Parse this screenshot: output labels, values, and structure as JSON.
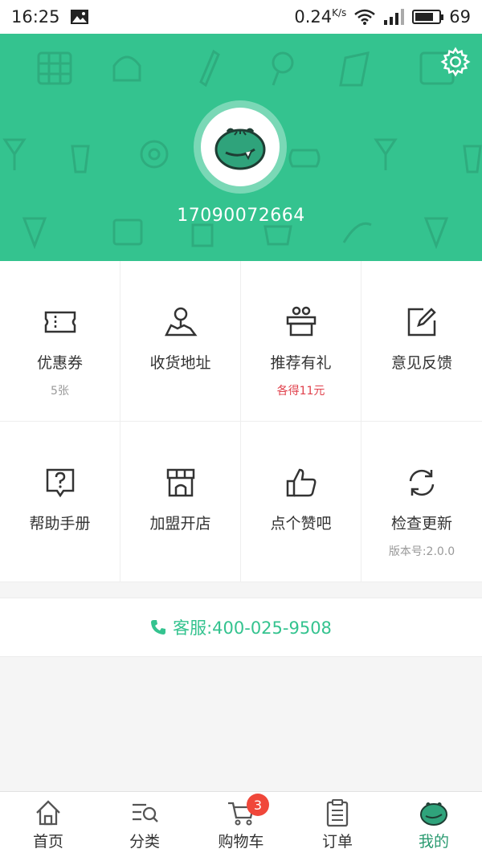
{
  "status_bar": {
    "time": "16:25",
    "network_speed": "0.24",
    "network_unit": "K/s",
    "battery": "69"
  },
  "header": {
    "phone": "17090072664",
    "background_color": "#34c38f"
  },
  "grid": {
    "items": [
      {
        "label": "优惠券",
        "sub": "5张",
        "icon": "ticket-icon"
      },
      {
        "label": "收货地址",
        "sub": "",
        "icon": "map-pin-icon"
      },
      {
        "label": "推荐有礼",
        "sub": "各得11元",
        "icon": "gift-icon"
      },
      {
        "label": "意见反馈",
        "sub": "",
        "icon": "edit-icon"
      },
      {
        "label": "帮助手册",
        "sub": "",
        "icon": "help-icon"
      },
      {
        "label": "加盟开店",
        "sub": "",
        "icon": "store-icon"
      },
      {
        "label": "点个赞吧",
        "sub": "",
        "icon": "thumbs-up-icon"
      },
      {
        "label": "检查更新",
        "sub": "版本号:2.0.0",
        "icon": "refresh-icon"
      }
    ]
  },
  "service": {
    "label": "客服:400-025-9508"
  },
  "tabbar": {
    "items": [
      {
        "label": "首页",
        "icon": "home-icon"
      },
      {
        "label": "分类",
        "icon": "category-search-icon"
      },
      {
        "label": "购物车",
        "icon": "cart-icon",
        "badge": "3"
      },
      {
        "label": "订单",
        "icon": "clipboard-icon"
      },
      {
        "label": "我的",
        "icon": "profile-mascot-icon"
      }
    ],
    "active_index": 4,
    "active_color": "#2a9a70"
  }
}
